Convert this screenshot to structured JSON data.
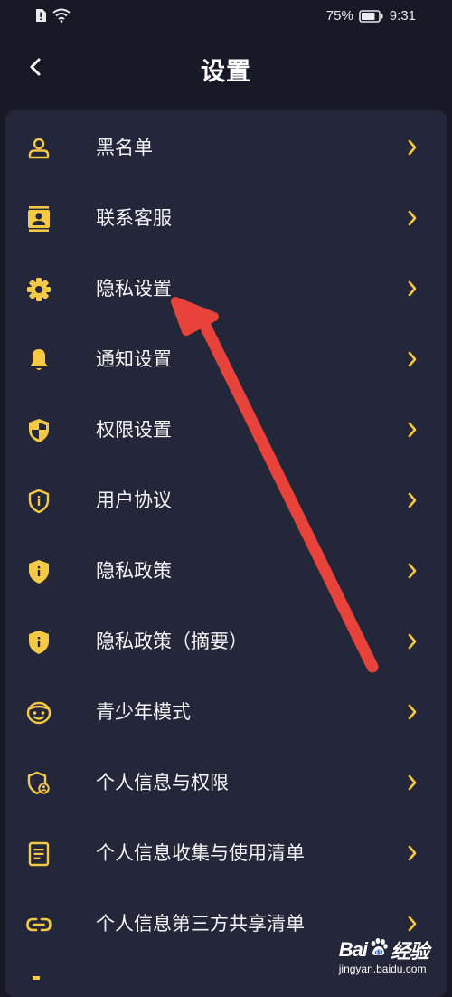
{
  "status_bar": {
    "battery": "75%",
    "time": "9:31"
  },
  "header": {
    "back_icon": "chevron-left-icon",
    "title": "设置"
  },
  "accent_color": "#f6c945",
  "settings": [
    {
      "label": "黑名单",
      "icon": "person-icon"
    },
    {
      "label": "联系客服",
      "icon": "contact-card-icon"
    },
    {
      "label": "隐私设置",
      "icon": "gear-icon"
    },
    {
      "label": "通知设置",
      "icon": "bell-icon"
    },
    {
      "label": "权限设置",
      "icon": "shield-icon"
    },
    {
      "label": "用户协议",
      "icon": "shield-info-outline-icon"
    },
    {
      "label": "隐私政策",
      "icon": "shield-info-icon"
    },
    {
      "label": "隐私政策（摘要）",
      "icon": "shield-info-icon"
    },
    {
      "label": "青少年模式",
      "icon": "smiley-face-icon"
    },
    {
      "label": "个人信息与权限",
      "icon": "shield-user-icon"
    },
    {
      "label": "个人信息收集与使用清单",
      "icon": "document-list-icon"
    },
    {
      "label": "个人信息第三方共享清单",
      "icon": "link-icon"
    }
  ],
  "annotation": {
    "type": "red-arrow",
    "color": "#e8433a",
    "points_to": "隐私设置"
  },
  "watermark": {
    "brand": "Bai",
    "brand_suffix": "经验",
    "url": "jingyan.baidu.com"
  }
}
